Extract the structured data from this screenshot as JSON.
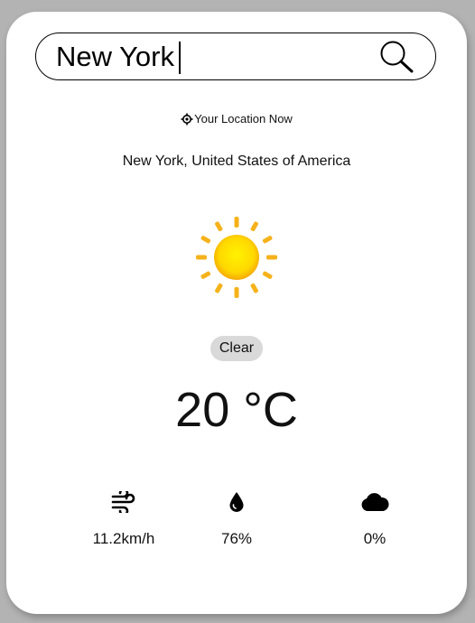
{
  "search": {
    "value": "New York",
    "icon": "search-icon"
  },
  "location_now": {
    "icon": "crosshair-icon",
    "label": "Your Location Now"
  },
  "city": "New York, United States of America",
  "weather": {
    "icon": "sun-icon",
    "condition": "Clear",
    "temperature": "20 °C"
  },
  "stats": [
    {
      "icon": "wind-icon",
      "value": "11.2km/h"
    },
    {
      "icon": "droplet-icon",
      "value": "76%"
    },
    {
      "icon": "cloud-icon",
      "value": "0%"
    }
  ],
  "colors": {
    "background": "#b3b3b3",
    "card": "#ffffff",
    "badge": "#d9d9d9",
    "sun_core": "#ffe000",
    "sun_ring": "#f5a800"
  }
}
